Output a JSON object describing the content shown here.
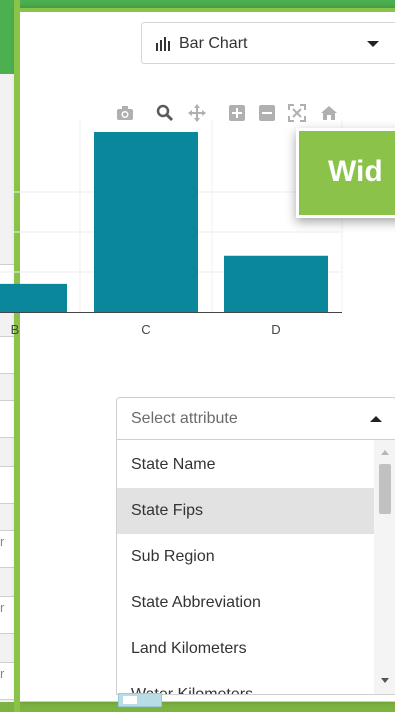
{
  "colors": {
    "bar": "#0a879a",
    "accent_green": "#8bc34a",
    "app_green": "#4caf50"
  },
  "background": {
    "left_fragments": [
      "r",
      "r",
      "r"
    ]
  },
  "chart_type_select": {
    "icon": "bar-chart-icon",
    "value": "Bar Chart"
  },
  "modebar": {
    "buttons": [
      {
        "name": "camera-icon"
      },
      {
        "name": "zoom-icon"
      },
      {
        "name": "pan-icon"
      },
      {
        "name": "zoom-in-icon"
      },
      {
        "name": "zoom-out-icon"
      },
      {
        "name": "autoscale-icon"
      },
      {
        "name": "home-icon"
      }
    ]
  },
  "widget_callout": {
    "label": "Wid"
  },
  "chart_data": {
    "type": "bar",
    "categories": [
      "B",
      "C",
      "D"
    ],
    "values": [
      0.25,
      1.6,
      0.5
    ],
    "visible_tick_text": [
      "B",
      "C",
      "D"
    ]
  },
  "attribute_select": {
    "placeholder": "Select attribute",
    "options": [
      "State Name",
      "State Fips",
      "Sub Region",
      "State Abbreviation",
      "Land Kilometers",
      "Water Kilometers"
    ],
    "selected": "State Fips"
  }
}
